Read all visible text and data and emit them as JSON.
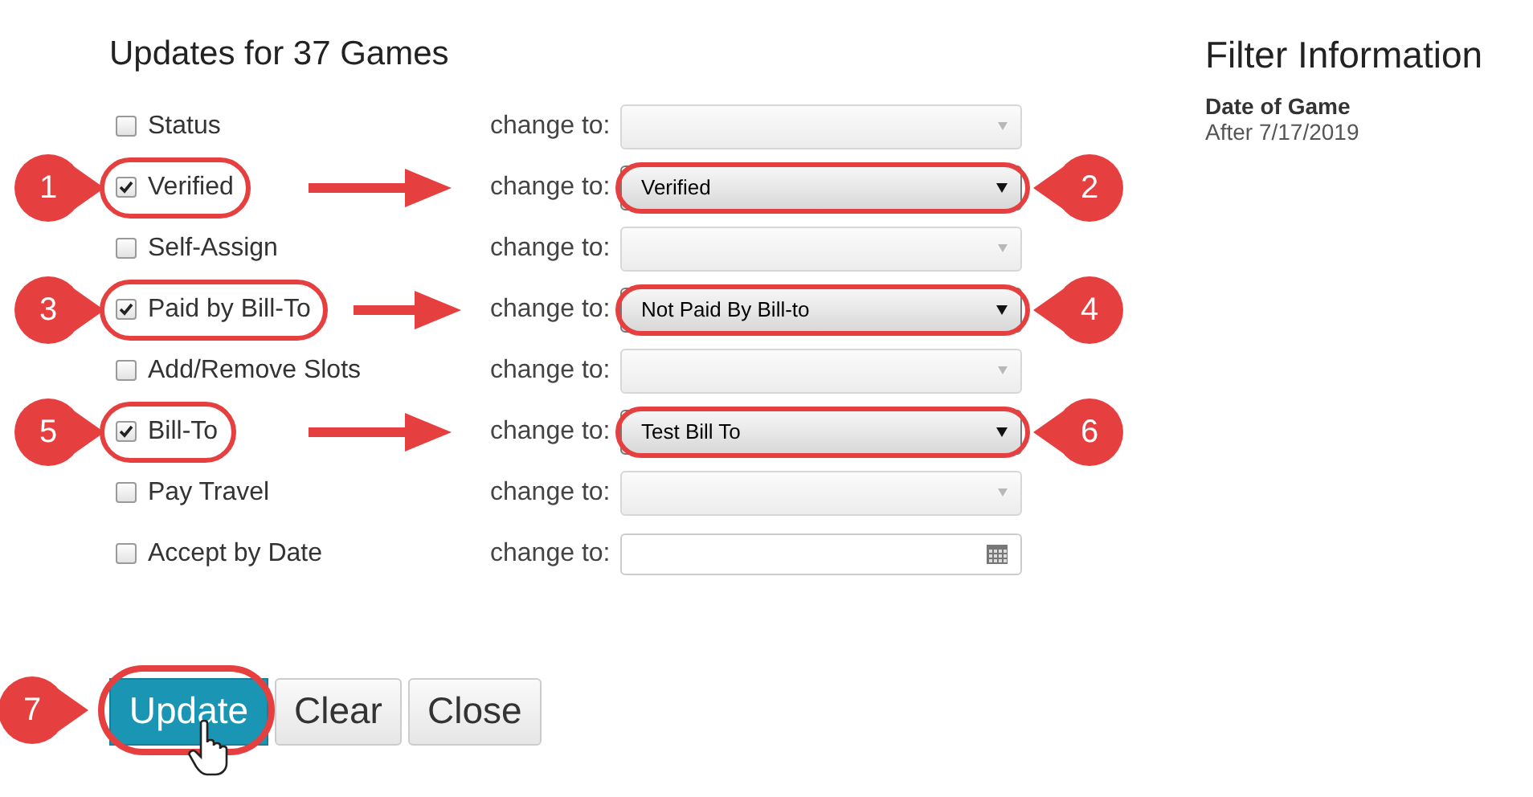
{
  "title": "Updates for 37 Games",
  "rows": [
    {
      "label": "Status",
      "checked": false,
      "change_label": "change to:",
      "kind": "select",
      "disabled": true
    },
    {
      "label": "Verified",
      "checked": true,
      "change_label": "change to:",
      "kind": "select",
      "disabled": false,
      "value": "Verified",
      "callouts": [
        "1",
        "2"
      ]
    },
    {
      "label": "Self-Assign",
      "checked": false,
      "change_label": "change to:",
      "kind": "select",
      "disabled": true
    },
    {
      "label": "Paid by Bill-To",
      "checked": true,
      "change_label": "change to:",
      "kind": "select",
      "disabled": false,
      "value": "Not Paid By Bill-to",
      "callouts": [
        "3",
        "4"
      ]
    },
    {
      "label": "Add/Remove Slots",
      "checked": false,
      "change_label": "change to:",
      "kind": "select",
      "disabled": true
    },
    {
      "label": "Bill-To",
      "checked": true,
      "change_label": "change to:",
      "kind": "select",
      "disabled": false,
      "value": "Test Bill To",
      "callouts": [
        "5",
        "6"
      ]
    },
    {
      "label": "Pay Travel",
      "checked": false,
      "change_label": "change to:",
      "kind": "select",
      "disabled": true
    },
    {
      "label": "Accept by Date",
      "checked": false,
      "change_label": "change to:",
      "kind": "date",
      "disabled": false
    }
  ],
  "buttons": [
    {
      "label": "Update",
      "kind": "primary",
      "callout": "7"
    },
    {
      "label": "Clear",
      "kind": "default"
    },
    {
      "label": "Close",
      "kind": "default"
    }
  ],
  "filter": {
    "title": "Filter Information",
    "field": "Date of Game",
    "value": "After 7/17/2019"
  }
}
